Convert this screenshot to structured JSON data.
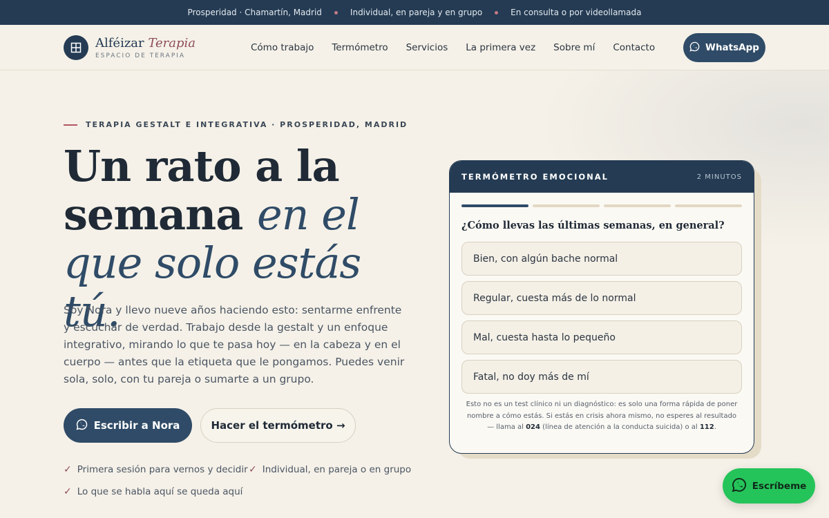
{
  "topbar": {
    "item1": "Prosperidad · Chamartín, Madrid",
    "item2": "Individual, en pareja y en grupo",
    "item3": "En consulta o por videollamada"
  },
  "header": {
    "brand_main": "Alféizar",
    "brand_italic": "Terapia",
    "brand_sub": "ESPACIO DE TERAPIA",
    "nav": [
      "Cómo trabajo",
      "Termómetro",
      "Servicios",
      "La primera vez",
      "Sobre mí",
      "Contacto"
    ],
    "whatsapp_label": "WhatsApp"
  },
  "hero": {
    "eyebrow": "TERAPIA GESTALT E INTEGRATIVA · PROSPERIDAD, MADRID",
    "headline_1": "Un rato a la",
    "headline_2": "semana ",
    "headline_2_it": "en el",
    "headline_3_it": "que solo estás tú.",
    "intro": "Soy Nora y llevo nueve años haciendo esto: sentarme enfrente y escuchar de verdad. Trabajo desde la gestalt y un enfoque integrativo, mirando lo que te pasa hoy — en la cabeza y en el cuerpo — antes que la etiqueta que le pongamos. Puedes venir sola, solo, con tu pareja o sumarte a un grupo.",
    "cta_primary": "Escribir a Nora",
    "cta_secondary": "Hacer el termómetro →",
    "checks": [
      "Primera sesión para vernos y decidir",
      "Individual, en pareja o en grupo",
      "Lo que se habla aquí se queda aquí"
    ]
  },
  "thermometer": {
    "title": "TERMÓMETRO EMOCIONAL",
    "duration": "2 MINUTOS",
    "step": 1,
    "steps_total": 4,
    "question": "¿Cómo llevas las últimas semanas, en general?",
    "options": [
      "Bien, con algún bache normal",
      "Regular, cuesta más de lo normal",
      "Mal, cuesta hasta lo pequeño",
      "Fatal, no doy más de mí"
    ],
    "disclaimer_a": "Esto no es un test clínico ni un diagnóstico: es solo una forma rápida de poner nombre a cómo estás. Si estás en crisis ahora mismo, no esperes al resultado — llama al ",
    "phone_1": "024",
    "disclaimer_b": " (línea de atención a la conducta suicida) o al ",
    "phone_2": "112",
    "disclaimer_c": "."
  },
  "floating": {
    "label": "Escríbeme"
  },
  "colors": {
    "navy": "#243b53",
    "accent": "#2f4b67",
    "rose": "#b45563",
    "whatsapp": "#25c45a",
    "cream": "#f5f1e8"
  },
  "icons": [
    "window-logo-icon",
    "whatsapp-icon",
    "check-icon"
  ]
}
